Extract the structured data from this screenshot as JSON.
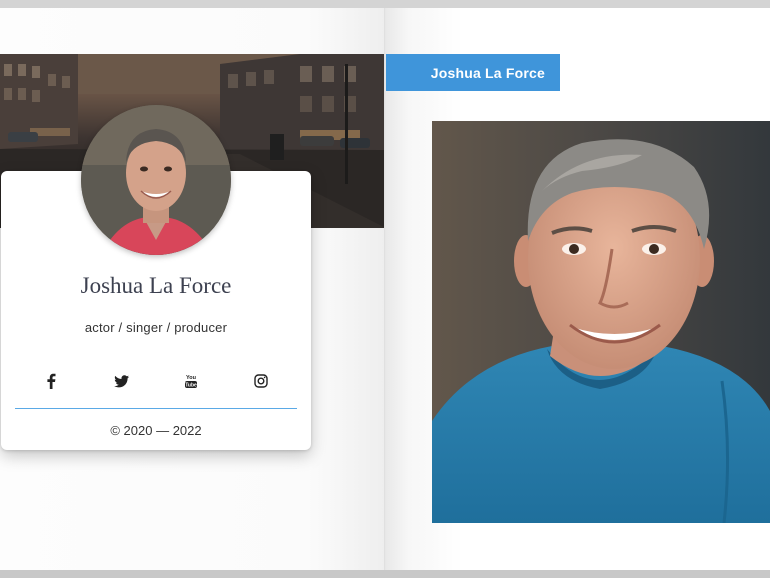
{
  "profile_card": {
    "name": "Joshua La Force",
    "role": "actor / singer / producer",
    "copyright": "© 2020 — 2022",
    "social": [
      {
        "icon": "facebook-icon"
      },
      {
        "icon": "twitter-icon"
      },
      {
        "icon": "youtube-icon"
      },
      {
        "icon": "instagram-icon"
      }
    ]
  },
  "right_page": {
    "name_tag": "Joshua La Force"
  },
  "colors": {
    "accent": "#3f95da",
    "divider": "#5aa9e6",
    "name_text": "#3d4150"
  }
}
